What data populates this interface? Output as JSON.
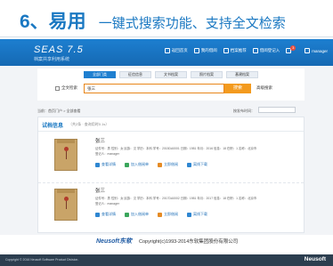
{
  "slide": {
    "number": "6、易用",
    "description": "一键式搜索功能、支持全文检索"
  },
  "app": {
    "logo_main": "SEAS 7.5",
    "logo_sub": "档案共享利用系统",
    "header_links": [
      "返回首页",
      "我的借阅",
      "档案推荐",
      "借阅登记入",
      "通知",
      "manager"
    ],
    "notification_count": "3",
    "tabs": [
      "全部门类",
      "征信信息",
      "文书档案",
      "照片档案",
      "基建档案"
    ],
    "active_tab_index": 0,
    "fulltext_label": "全文检索",
    "search_value": "张三",
    "search_button": "搜索",
    "advanced_search": "高级搜索",
    "breadcrumb": "当前：首页门户 > 全部查看",
    "sort_label": "按发布时间：",
    "sort_value": "",
    "results_title": "试档信息",
    "results_note": "（共2条 · 查询用时0.1s）",
    "records": [
      {
        "name": "张三",
        "meta1": "证件号：男   性别：女   民族：汉   学历：本科   学号：2015DA0001   日期：1981   年月：2016   信息：18   在职：1   名称：北京市",
        "meta2": "登记人：manager",
        "actions": [
          "查看详情",
          "加入借阅单",
          "立即借阅",
          "离线下载"
        ]
      },
      {
        "name": "张三",
        "meta1": "证件号：男   性别：女   民族：汉   学历：本科   学号：2017DA0002   日期：1981   年月：2017   信息：18   在职：1   名称：北京市",
        "meta2": "登记人：manager",
        "actions": [
          "查看详情",
          "加入借阅单",
          "立即借阅",
          "离线下载"
        ]
      }
    ],
    "footer_logo": "Neusoft东软",
    "copyright": "Copyright(c)1993-2014东软集团股份有限公司"
  },
  "slide_footer": {
    "text": "Copyright © 2016 Neusoft Software Product Division.",
    "brand": "Neusoft"
  },
  "colors": {
    "title_blue": "#1a78c2",
    "header_blue": "#1569b3",
    "search_orange": "#f39a1e",
    "footer_dark": "#2c3e4f"
  }
}
